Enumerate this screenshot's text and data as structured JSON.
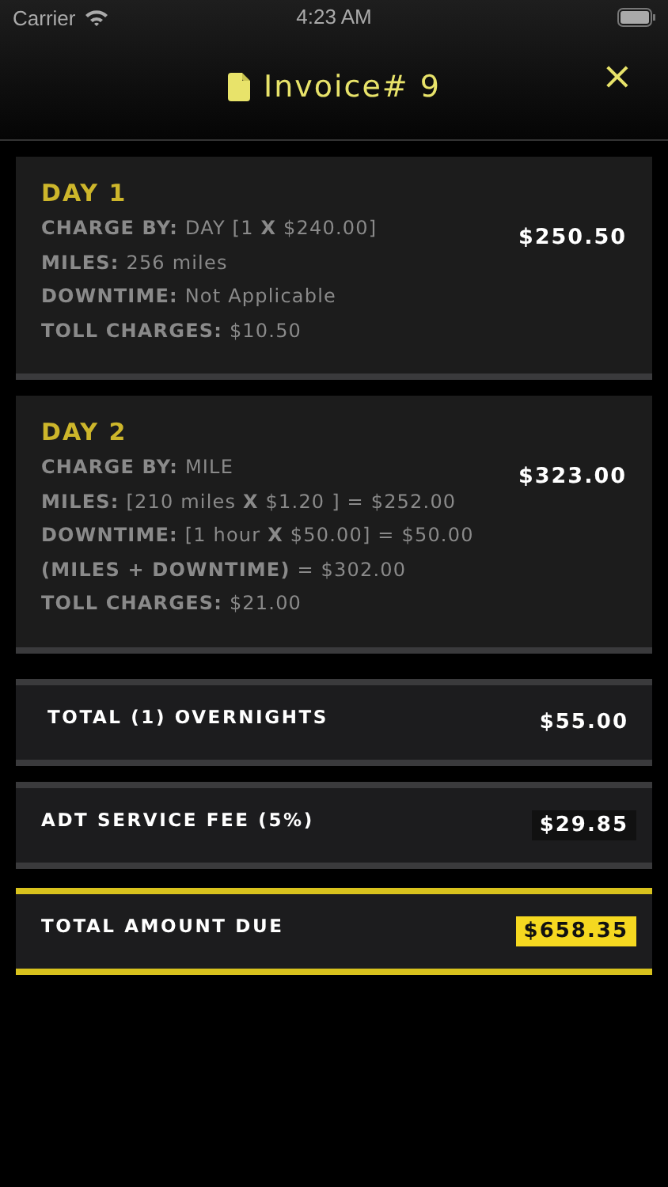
{
  "status_bar": {
    "carrier": "Carrier",
    "time": "4:23 AM"
  },
  "header": {
    "title": "Invoice# 9",
    "close": "×"
  },
  "days": [
    {
      "title": "DAY 1",
      "amount": "$250.50",
      "lines": [
        "**CHARGE BY:** DAY [1 **X** $240.00]",
        "**MILES:** 256 miles",
        "**DOWNTIME:** Not Applicable",
        "**TOLL CHARGES:** $10.50"
      ]
    },
    {
      "title": "DAY 2",
      "amount": "$323.00",
      "lines": [
        "**CHARGE BY:** MILE",
        "**MILES:** [210 miles **X** $1.20 ] = $252.00",
        "**DOWNTIME:**  [1 hour **X** $50.00] = $50.00",
        "**(MILES + DOWNTIME)** = $302.00",
        "**TOLL CHARGES:** $21.00"
      ]
    }
  ],
  "summary": [
    {
      "kind": "plain",
      "label": "TOTAL (1) OVERNIGHTS",
      "amount": "$55.00"
    },
    {
      "kind": "boxed",
      "label": "ADT SERVICE FEE (5%)",
      "amount": "$29.85"
    },
    {
      "kind": "highlight",
      "label": "TOTAL AMOUNT DUE",
      "amount": "$658.35"
    }
  ]
}
